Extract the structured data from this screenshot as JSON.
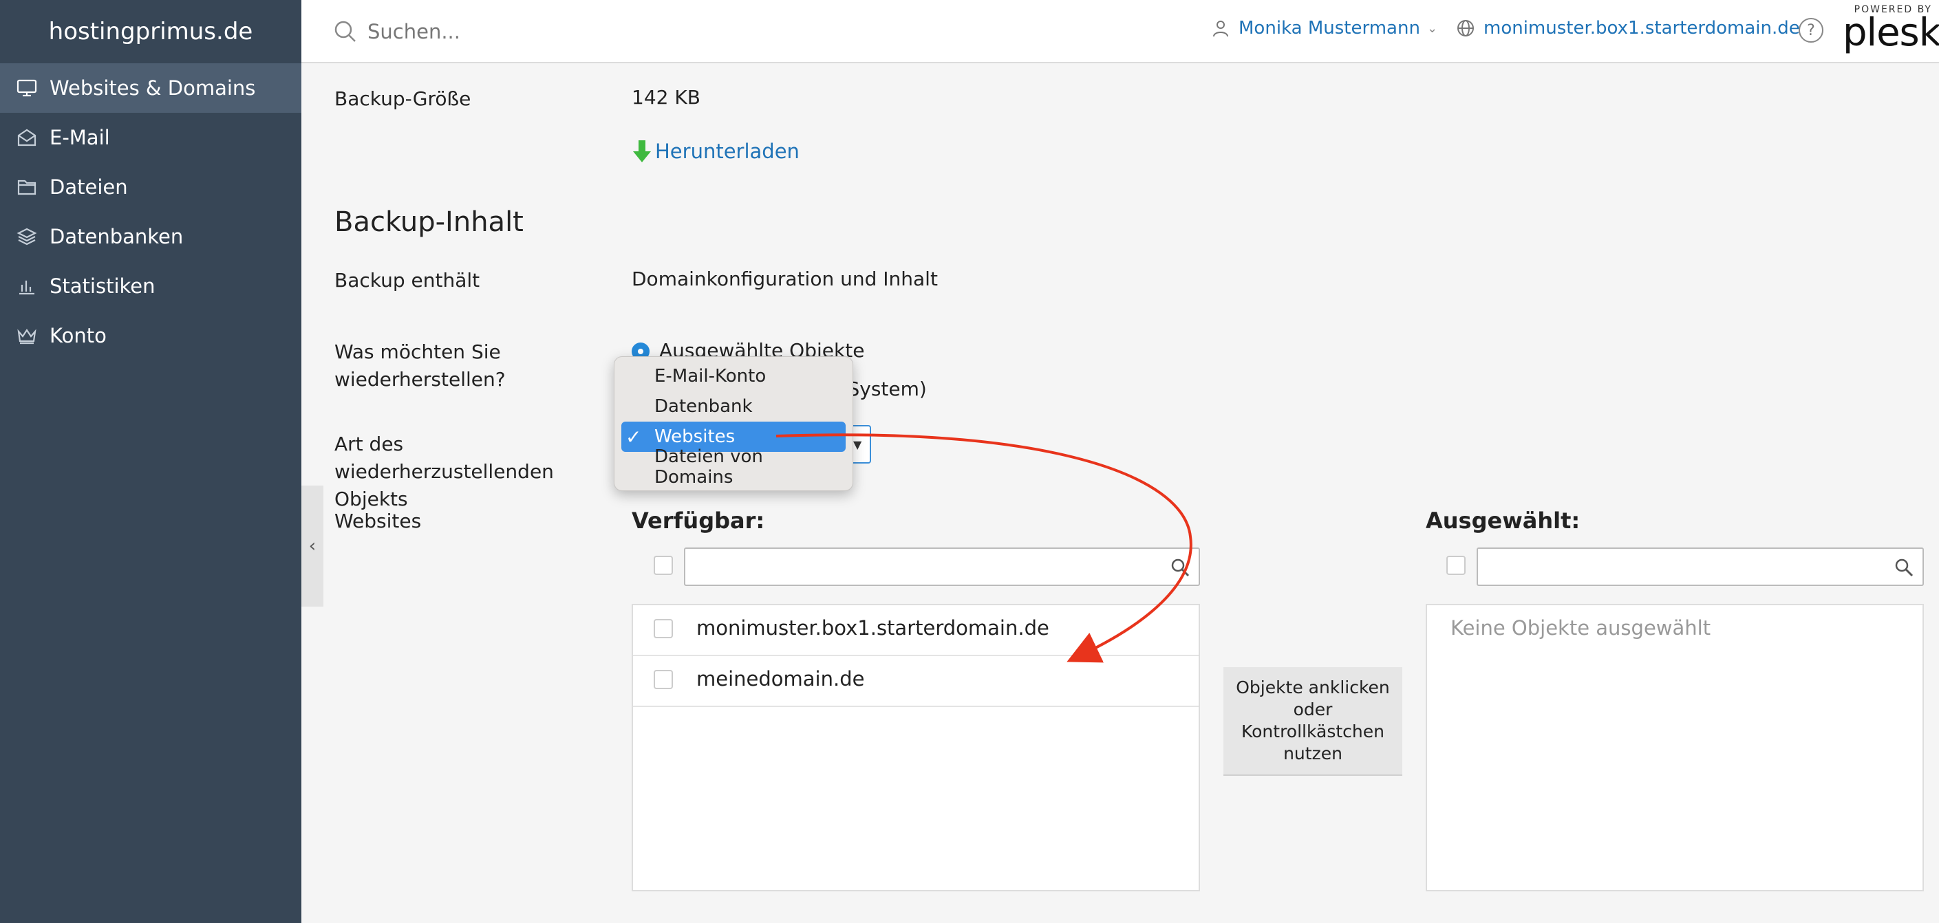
{
  "sidebar": {
    "brand": "hostingprimus.de",
    "items": [
      {
        "label": "Websites & Domains",
        "icon": "monitor-icon",
        "active": true
      },
      {
        "label": "E-Mail",
        "icon": "envelope-icon",
        "active": false
      },
      {
        "label": "Dateien",
        "icon": "folder-icon",
        "active": false
      },
      {
        "label": "Datenbanken",
        "icon": "database-icon",
        "active": false
      },
      {
        "label": "Statistiken",
        "icon": "bar-chart-icon",
        "active": false
      },
      {
        "label": "Konto",
        "icon": "crown-icon",
        "active": false
      }
    ]
  },
  "header": {
    "search_placeholder": "Suchen...",
    "user_name": "Monika Mustermann",
    "domain": "monimuster.box1.starterdomain.de",
    "powered_by": "POWERED BY",
    "logo_text": "plesk"
  },
  "backup": {
    "size_label": "Backup-Größe",
    "size_value": "142 KB",
    "download_label": "Herunterladen",
    "section_title": "Backup-Inhalt",
    "contains_label": "Backup enthält",
    "contains_value": "Domainkonfiguration und Inhalt",
    "restore_question": "Was möchten Sie wiederherstellen?",
    "restore_option_1": "Ausgewählte Objekte",
    "restore_option_2_tail": "s System)",
    "object_type_label": "Art des wiederherzustellenden Objekts",
    "websites_label": "Websites"
  },
  "dropdown": {
    "options": [
      "E-Mail-Konto",
      "Datenbank",
      "Websites",
      "Dateien von Domains"
    ],
    "selected_index": 2,
    "check_mark": "✓"
  },
  "available": {
    "title": "Verfügbar:",
    "rows": [
      "monimuster.box1.starterdomain.de",
      "meinedomain.de"
    ]
  },
  "transfer_hint": "Objekte anklicken oder Kontrollkästchen nutzen",
  "selected": {
    "title": "Ausgewählt:",
    "empty_text": "Keine Objekte ausgewählt"
  },
  "colors": {
    "sidebar_bg": "#374656",
    "accent_blue": "#1f73b7",
    "selection_blue": "#3b8fe6",
    "annotation_red": "#e8341c",
    "download_green": "#3fb93f"
  }
}
